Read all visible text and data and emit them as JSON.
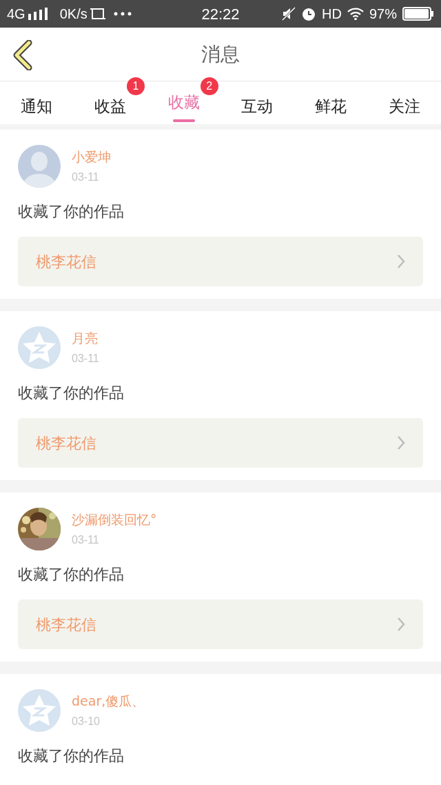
{
  "status_bar": {
    "network": "4G",
    "speed": "0K/s",
    "time": "22:22",
    "hd": "HD",
    "battery": "97%"
  },
  "header": {
    "title": "消息"
  },
  "tabs": [
    {
      "label": "通知",
      "selected": false
    },
    {
      "label": "收益",
      "selected": false,
      "badge": "1"
    },
    {
      "label": "收藏",
      "selected": true,
      "badge": "2"
    },
    {
      "label": "互动",
      "selected": false
    },
    {
      "label": "鲜花",
      "selected": false
    },
    {
      "label": "关注",
      "selected": false
    }
  ],
  "messages": [
    {
      "kind": "silhouette",
      "name": "小爱坤",
      "date": "03-11",
      "action": "收藏了你的作品",
      "work": "桃李花信"
    },
    {
      "kind": "star",
      "name": "月亮",
      "date": "03-11",
      "action": "收藏了你的作品",
      "work": "桃李花信"
    },
    {
      "kind": "picture",
      "name": "沙漏倒装回忆°",
      "date": "03-11",
      "action": "收藏了你的作品",
      "work": "桃李花信"
    },
    {
      "kind": "star",
      "name": "dear,傻瓜、",
      "date": "03-10",
      "action": "收藏了你的作品"
    }
  ]
}
